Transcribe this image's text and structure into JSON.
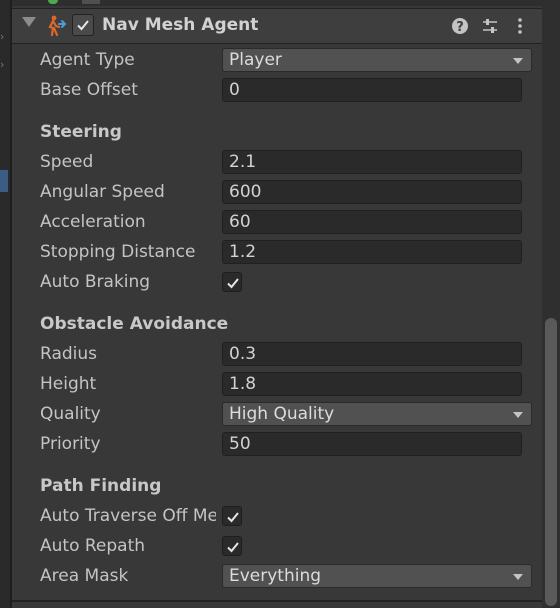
{
  "component": {
    "title": "Nav Mesh Agent",
    "enabled": true
  },
  "colors": {
    "panel_bg": "#383838",
    "field_bg": "#2a2a2a",
    "dropdown_bg": "#515151",
    "selection": "#3c5d83",
    "agent_icon_orange": "#e0672a",
    "agent_icon_blue": "#4a9be0"
  },
  "header_icons": [
    "help-icon",
    "presets-icon",
    "kebab-menu-icon"
  ],
  "agent": {
    "agent_type_label": "Agent Type",
    "agent_type_value": "Player",
    "base_offset_label": "Base Offset",
    "base_offset_value": "0"
  },
  "steering": {
    "header": "Steering",
    "speed_label": "Speed",
    "speed_value": "2.1",
    "angular_speed_label": "Angular Speed",
    "angular_speed_value": "600",
    "acceleration_label": "Acceleration",
    "acceleration_value": "60",
    "stopping_distance_label": "Stopping Distance",
    "stopping_distance_value": "1.2",
    "auto_braking_label": "Auto Braking",
    "auto_braking_checked": true
  },
  "obstacle_avoidance": {
    "header": "Obstacle Avoidance",
    "radius_label": "Radius",
    "radius_value": "0.3",
    "height_label": "Height",
    "height_value": "1.8",
    "quality_label": "Quality",
    "quality_value": "High Quality",
    "priority_label": "Priority",
    "priority_value": "50"
  },
  "path_finding": {
    "header": "Path Finding",
    "auto_traverse_label": "Auto Traverse Off Me",
    "auto_traverse_checked": true,
    "auto_repath_label": "Auto Repath",
    "auto_repath_checked": true,
    "area_mask_label": "Area Mask",
    "area_mask_value": "Everything"
  }
}
